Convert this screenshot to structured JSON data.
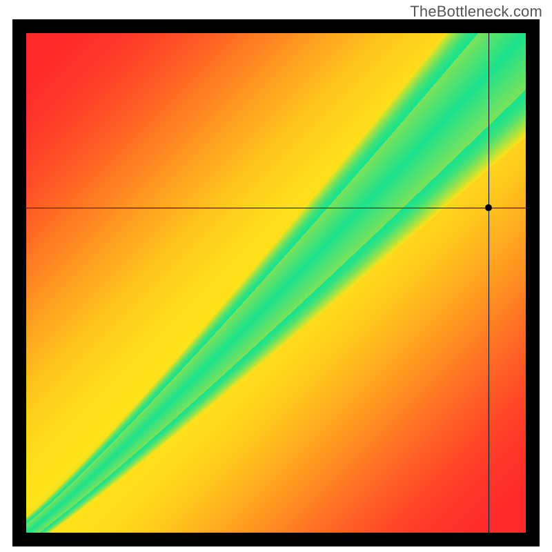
{
  "watermark_text": "TheBottleneck.com",
  "chart_data": {
    "type": "heatmap",
    "title": "",
    "xlabel": "",
    "ylabel": "",
    "xlim": [
      0,
      1
    ],
    "ylim": [
      0,
      1
    ],
    "description": "Bottleneck compatibility heatmap. Axes are normalized component scores (0–1). Color encodes fit: green = balanced pairing, yellow = mild bottleneck, red = severe bottleneck. The green band follows roughly y ≈ x from the origin to the top-right, widening slightly at the high end.",
    "color_scale": [
      {
        "stop": 0.0,
        "color": "#ff2a2a",
        "meaning": "severe bottleneck"
      },
      {
        "stop": 0.5,
        "color": "#f6e21a",
        "meaning": "mild bottleneck"
      },
      {
        "stop": 1.0,
        "color": "#1be28c",
        "meaning": "balanced"
      }
    ],
    "marker": {
      "x": 0.925,
      "y": 0.65
    },
    "crosshair": {
      "x": 0.925,
      "y": 0.65
    }
  }
}
